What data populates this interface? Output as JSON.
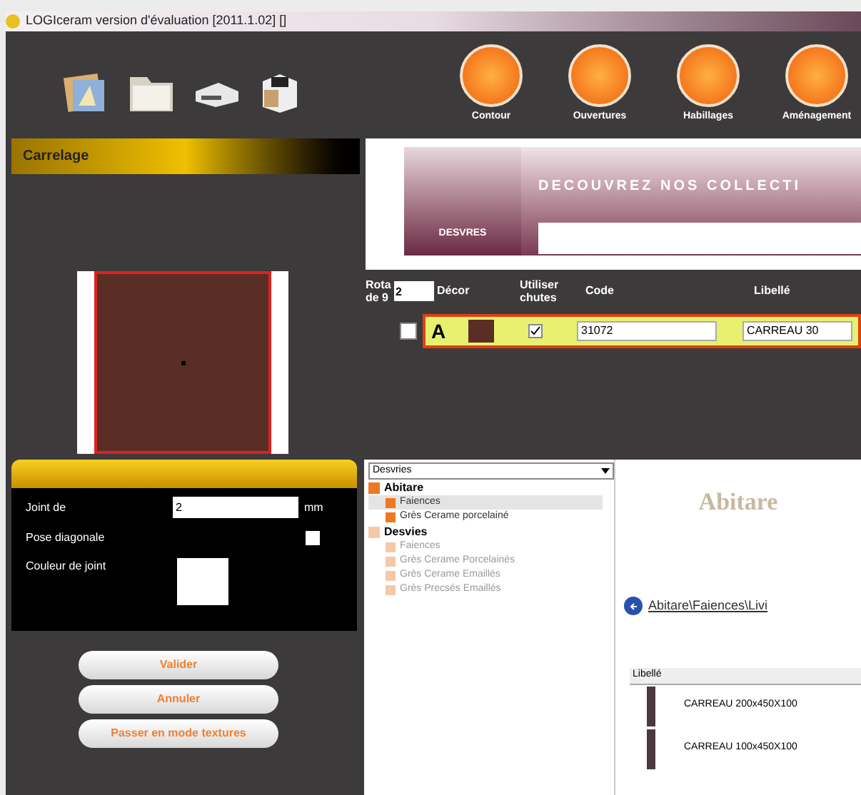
{
  "window": {
    "title": "LOGIceram version d'évaluation [2011.1.02] []"
  },
  "toolbar": {
    "tools": [
      {
        "kind": "photo"
      },
      {
        "kind": "folder"
      },
      {
        "kind": "printer"
      },
      {
        "kind": "box"
      }
    ],
    "modes": [
      {
        "label": "Contour"
      },
      {
        "label": "Ouvertures"
      },
      {
        "label": "Habillages"
      },
      {
        "label": "Aménagement"
      }
    ]
  },
  "left_panel": {
    "title": "Carrelage",
    "joint": {
      "label": "Joint de",
      "value": "2",
      "unit": "mm"
    },
    "diagonal": {
      "label": "Pose diagonale",
      "checked": false
    },
    "joint_color": {
      "label": "Couleur de joint",
      "color": "#ffffff"
    },
    "buttons": [
      "Valider",
      "Annuler",
      "Passer en mode textures"
    ]
  },
  "banner": {
    "brand": "DESVRES",
    "headline": "DECOUVREZ NOS COLLECTI"
  },
  "tile_table": {
    "rotation_label": "Rota de 9",
    "rotation_value": "2",
    "columns": [
      "Décor",
      "Utiliser chutes",
      "Code",
      "Libellé"
    ],
    "rows": [
      {
        "selected": false,
        "letter": "A",
        "color": "#5a2e24",
        "use_offcuts": true,
        "code": "31072",
        "label": "CARREAU 30"
      }
    ]
  },
  "catalog": {
    "brand_select": "Desvries",
    "tree": [
      {
        "label": "Abitare",
        "color": "#f07820",
        "children": [
          {
            "label": "Faiences",
            "selected": true
          },
          {
            "label": "Grès Cerame porcelainé",
            "selected": false
          }
        ]
      },
      {
        "label": "Desvies",
        "color": "#f5c8a8",
        "children": [
          {
            "label": "Faiences",
            "selected": false
          },
          {
            "label": "Grès Cerame Porcelainés",
            "selected": false
          },
          {
            "label": "Grès Cerame Emaillés",
            "selected": false
          },
          {
            "label": "Grès Precsés Emaillés",
            "selected": false
          }
        ]
      }
    ],
    "logo": "Abitare",
    "path": "Abitare\\Faiences\\Livi",
    "products_header": "Libellé",
    "products": [
      {
        "label": "CARREAU 200x450X100"
      },
      {
        "label": "CARREAU 100x450X100"
      }
    ]
  }
}
